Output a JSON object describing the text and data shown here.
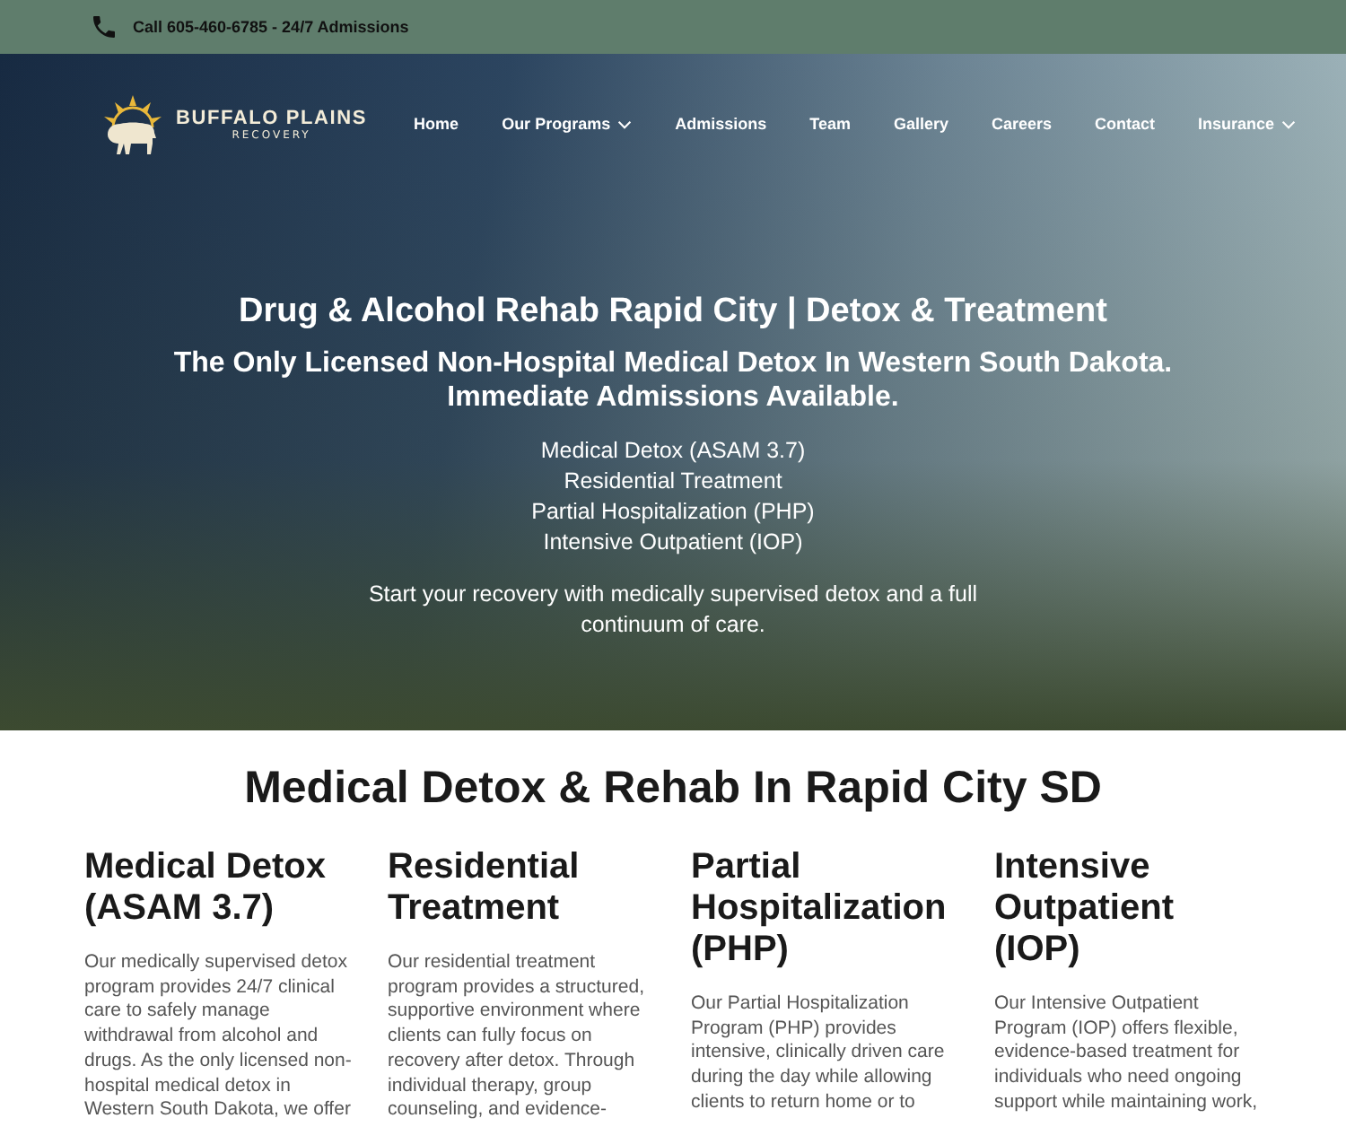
{
  "top_bar": {
    "text": "Call 605-460-6785 - 24/7 Admissions"
  },
  "logo": {
    "name": "BUFFALO PLAINS",
    "tagline": "RECOVERY"
  },
  "nav": [
    {
      "label": "Home",
      "dropdown": false
    },
    {
      "label": "Our Programs",
      "dropdown": true
    },
    {
      "label": "Admissions",
      "dropdown": false
    },
    {
      "label": "Team",
      "dropdown": false
    },
    {
      "label": "Gallery",
      "dropdown": false
    },
    {
      "label": "Careers",
      "dropdown": false
    },
    {
      "label": "Contact",
      "dropdown": false
    },
    {
      "label": "Insurance",
      "dropdown": true
    }
  ],
  "hero": {
    "title": "Drug & Alcohol Rehab Rapid City | Detox & Treatment",
    "subtitle": "The Only Licensed Non-Hospital Medical Detox In Western South Dakota. Immediate Admissions Available.",
    "programs": [
      "Medical Detox (ASAM 3.7)",
      "Residential Treatment",
      "Partial Hospitalization (PHP)",
      "Intensive Outpatient (IOP)"
    ],
    "text": "Start your recovery with medically supervised detox and a full continuum of care."
  },
  "section": {
    "title": "Medical Detox & Rehab In Rapid City SD",
    "columns": [
      {
        "title": "Medical Detox (ASAM 3.7)",
        "text": "Our medically supervised detox program provides 24/7 clinical care to safely manage withdrawal from alcohol and drugs. As the only licensed non-hospital medical detox in Western South Dakota, we offer"
      },
      {
        "title": "Residential Treatment",
        "text": "Our residential treatment program provides a structured, supportive environment where clients can fully focus on recovery after detox. Through individual therapy, group counseling, and evidence-"
      },
      {
        "title": "Partial Hospitalization (PHP)",
        "text": "Our Partial Hospitalization Program (PHP) provides intensive, clinically driven care during the day while allowing clients to return home or to"
      },
      {
        "title": "Intensive Outpatient (IOP)",
        "text": "Our Intensive Outpatient Program (IOP) offers flexible, evidence-based treatment for individuals who need ongoing support while maintaining work,"
      }
    ]
  }
}
